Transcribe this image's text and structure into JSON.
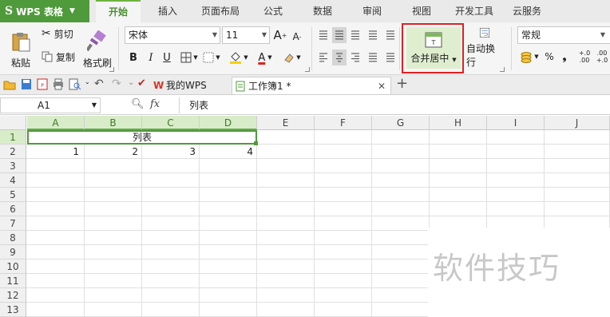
{
  "app": {
    "name": "WPS 表格",
    "logo_char": "S"
  },
  "menu": {
    "tabs": [
      "开始",
      "插入",
      "页面布局",
      "公式",
      "数据",
      "审阅",
      "视图",
      "开发工具",
      "云服务"
    ],
    "active": "开始"
  },
  "ribbon": {
    "paste": "粘贴",
    "cut": "剪切",
    "copy": "复制",
    "format_painter": "格式刷",
    "font_name": "宋体",
    "font_size": "11",
    "bold": "B",
    "italic": "I",
    "underline": "U",
    "font_color_glyph": "A",
    "merge_center": "合并居中",
    "wrap_text": "自动换行",
    "number_format": "常规",
    "percent": "%",
    "comma": "❟",
    "inc_decimal_top": "+.0",
    "inc_decimal_bottom": ".00",
    "dec_decimal_top": ".00",
    "dec_decimal_bottom": "+.0",
    "highlight_color": "#e02020"
  },
  "doc_tabs": [
    {
      "label": "我的WPS",
      "active": false
    },
    {
      "label": "工作簿1 *",
      "active": true
    }
  ],
  "formula_bar": {
    "name_box": "A1",
    "fx": "fx",
    "content": "列表"
  },
  "sheet": {
    "columns": [
      "A",
      "B",
      "C",
      "D",
      "E",
      "F",
      "G",
      "H",
      "I",
      "J"
    ],
    "selected_columns": [
      "A",
      "B",
      "C",
      "D"
    ],
    "rows": [
      "1",
      "2",
      "3",
      "4",
      "5",
      "6",
      "7",
      "8",
      "9",
      "10",
      "11",
      "12",
      "13"
    ],
    "merged_A1_D1": "列表",
    "row2": [
      "1",
      "2",
      "3",
      "4"
    ]
  },
  "watermark": "软件技巧"
}
